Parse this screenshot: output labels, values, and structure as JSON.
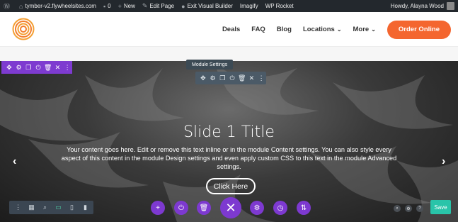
{
  "admin_bar": {
    "site": "tymber-v2.flywheelsites.com",
    "comments": "0",
    "new": "New",
    "edit_page": "Edit Page",
    "exit_builder": "Exit Visual Builder",
    "imagify": "Imagify",
    "wp_rocket": "WP Rocket",
    "howdy": "Howdy, Alayna Wood"
  },
  "nav": {
    "items": [
      "Deals",
      "FAQ",
      "Blog",
      "Locations",
      "More"
    ],
    "order_button": "Order Online"
  },
  "slide": {
    "title": "Slide 1 Title",
    "body": "Your content goes here. Edit or remove this text inline or in the module Content settings. You can also style every aspect of this content in the module Design settings and even apply custom CSS to this text in the module Advanced settings.",
    "button": "Click Here",
    "prev": "‹",
    "next": "›"
  },
  "module_tooltip": "Module Settings",
  "save_label": "Save",
  "colors": {
    "accent_purple": "#7e3bd0",
    "order_orange": "#f4662f",
    "save_green": "#29c4a9",
    "logo_orange": "#f4a035"
  },
  "icons": {
    "section_toolbar": [
      "move-icon",
      "gear-icon",
      "duplicate-icon",
      "power-icon",
      "trash-icon",
      "close-icon",
      "more-icon"
    ],
    "module_toolbar": [
      "move-icon",
      "gear-icon",
      "duplicate-icon",
      "power-icon",
      "trash-icon",
      "close-icon",
      "more-icon"
    ],
    "view_bar": [
      "more-icon",
      "wireframe-icon",
      "zoom-icon",
      "desktop-icon",
      "tablet-icon",
      "phone-icon"
    ],
    "page_actions": [
      "add-icon",
      "power-icon",
      "trash-icon",
      "close-icon",
      "gear-icon",
      "history-icon",
      "portability-icon"
    ]
  }
}
